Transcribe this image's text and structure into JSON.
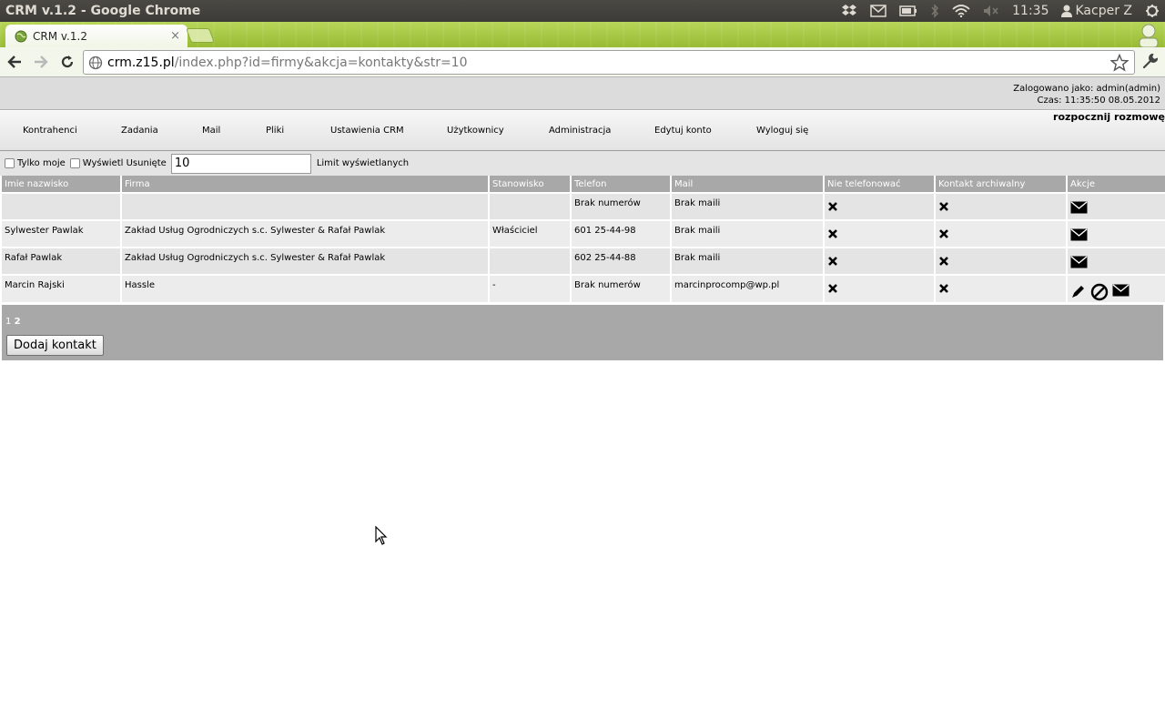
{
  "os": {
    "window_title": "CRM v.1.2 - Google Chrome",
    "time": "11:35",
    "user": "Kacper Z"
  },
  "browser": {
    "tab_title": "CRM v.1.2",
    "tab_close": "×",
    "url_domain": "crm.z15.pl",
    "url_path": "/index.php?id=firmy&akcja=kontakty&str=10"
  },
  "header": {
    "logged_in": "Zalogowano jako: admin(admin)",
    "time": "Czas: 11:35:50 08.05.2012",
    "start_talk": "rozpocznij rozmowę"
  },
  "menu": {
    "items": [
      "Kontrahenci",
      "Zadania",
      "Mail",
      "Pliki",
      "Ustawienia CRM",
      "Użytkownicy",
      "Administracja",
      "Edytuj konto",
      "Wyloguj się"
    ]
  },
  "filters": {
    "only_mine": "Tylko moje",
    "show_deleted": "Wyświetl Usunięte",
    "limit_value": "10",
    "limit_label": "Limit wyświetlanych"
  },
  "table": {
    "headers": [
      "Imie nazwisko",
      "Firma",
      "Stanowisko",
      "Telefon",
      "Mail",
      "Nie telefonować",
      "Kontakt archiwalny",
      "Akcje"
    ],
    "rows": [
      {
        "name": "",
        "company": "",
        "position": "",
        "phone": "Brak numerów",
        "mail": "Brak maili"
      },
      {
        "name": "Sylwester Pawlak",
        "company": "Zakład Usług Ogrodniczych s.c. Sylwester & Rafał Pawlak",
        "position": "Właściciel",
        "phone": "601 25-44-98",
        "mail": "Brak maili"
      },
      {
        "name": "Rafał Pawlak",
        "company": "Zakład Usług Ogrodniczych s.c. Sylwester & Rafał Pawlak",
        "position": "",
        "phone": "602 25-44-88",
        "mail": "Brak maili"
      },
      {
        "name": "Marcin Rajski",
        "company": "Hassle",
        "position": "-",
        "phone": "Brak numerów",
        "mail": "marcinprocomp@wp.pl"
      }
    ]
  },
  "pager": {
    "page1": "1",
    "page2": "2"
  },
  "add_button": "Dodaj kontakt",
  "icons": {
    "no_call": "x-icon",
    "archive": "x-icon",
    "mail": "envelope-icon",
    "edit": "pencil-icon",
    "block": "ban-icon"
  }
}
